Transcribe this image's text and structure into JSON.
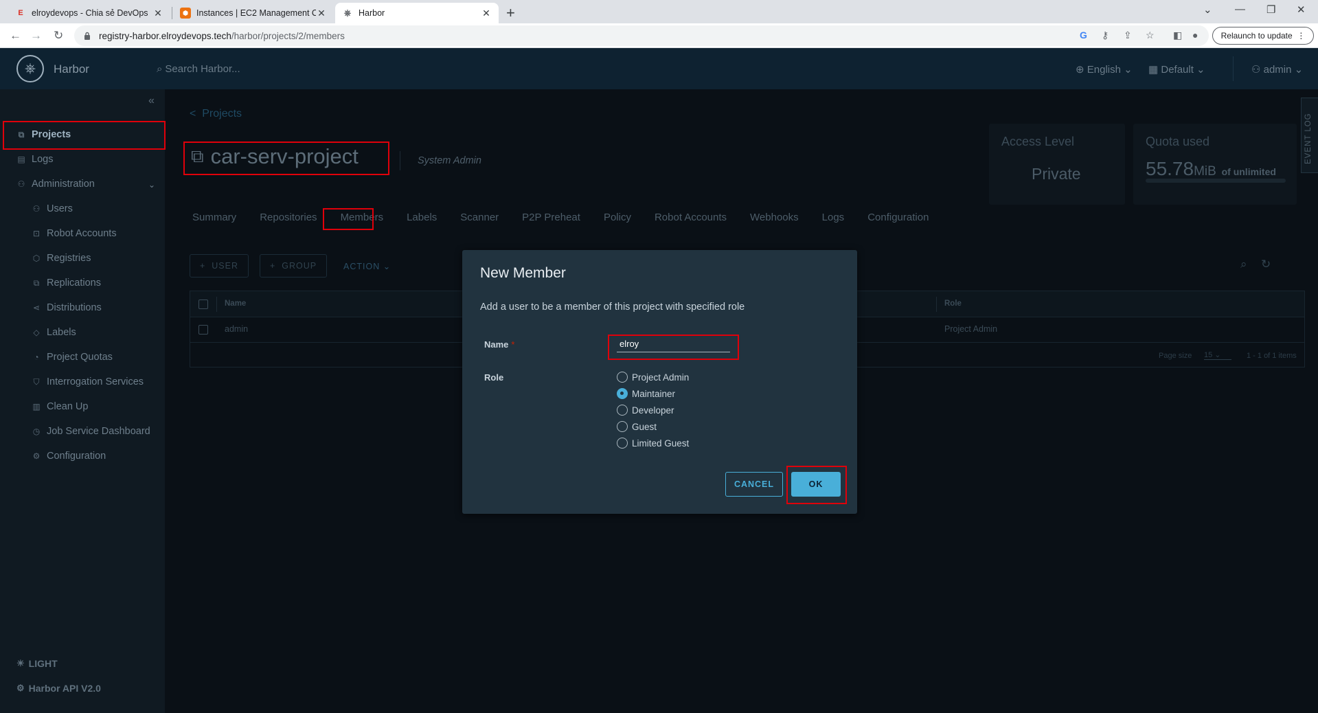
{
  "browser": {
    "tabs": [
      {
        "title": "elroydevops - Chia sẻ DevOps",
        "favicon": "E"
      },
      {
        "title": "Instances | EC2 Management Console",
        "favicon": "⬢"
      },
      {
        "title": "Harbor",
        "favicon": "⎈"
      }
    ],
    "url_host": "registry-harbor.elroydevops.tech",
    "url_path": "/harbor/projects/2/members",
    "relaunch_label": "Relaunch to update"
  },
  "header": {
    "brand": "Harbor",
    "search_placeholder": "Search Harbor...",
    "language": "English",
    "theme": "Default",
    "user": "admin"
  },
  "sidebar": {
    "projects": "Projects",
    "logs": "Logs",
    "administration": "Administration",
    "admin_items": [
      "Users",
      "Robot Accounts",
      "Registries",
      "Replications",
      "Distributions",
      "Labels",
      "Project Quotas",
      "Interrogation Services",
      "Clean Up",
      "Job Service Dashboard",
      "Configuration"
    ],
    "light": "LIGHT",
    "api": "Harbor API V2.0"
  },
  "main": {
    "breadcrumb": "Projects",
    "project_name": "car-serv-project",
    "role": "System Admin",
    "access_level_label": "Access Level",
    "access_level_value": "Private",
    "quota_label": "Quota used",
    "quota_value": "55.78",
    "quota_unit": "MiB",
    "quota_limit": "of unlimited",
    "tabs": [
      "Summary",
      "Repositories",
      "Members",
      "Labels",
      "Scanner",
      "P2P Preheat",
      "Policy",
      "Robot Accounts",
      "Webhooks",
      "Logs",
      "Configuration"
    ],
    "user_btn": "USER",
    "group_btn": "GROUP",
    "action_btn": "ACTION",
    "columns": {
      "name": "Name",
      "role": "Role"
    },
    "rows": [
      {
        "name": "admin",
        "role": "Project Admin"
      }
    ],
    "page_size_label": "Page size",
    "page_size": "15",
    "items_count": "1 - 1 of 1 items",
    "event_log": "EVENT LOG"
  },
  "modal": {
    "title": "New Member",
    "description": "Add a user to be a member of this project with specified role",
    "name_label": "Name",
    "name_value": "elroy",
    "role_label": "Role",
    "roles": [
      "Project Admin",
      "Maintainer",
      "Developer",
      "Guest",
      "Limited Guest"
    ],
    "selected_role": "Maintainer",
    "cancel": "CANCEL",
    "ok": "OK"
  }
}
